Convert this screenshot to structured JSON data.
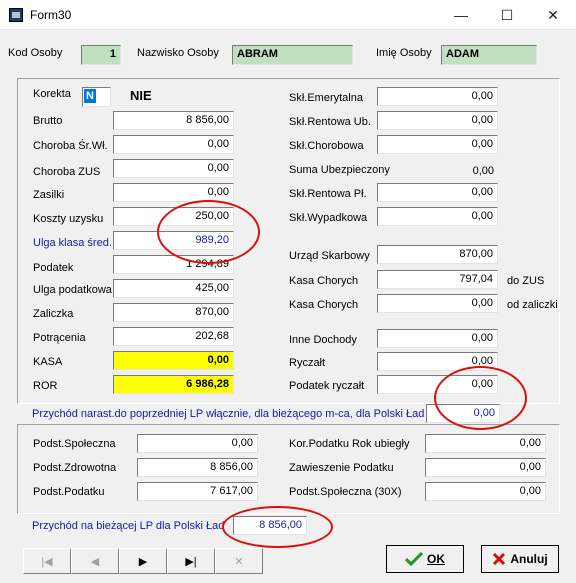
{
  "window": {
    "title": "Form30",
    "controls": {
      "minimize": "—",
      "maximize": "☐",
      "close": "✕"
    }
  },
  "header": {
    "kod_label": "Kod Osoby",
    "kod_value": "1",
    "nazwisko_label": "Nazwisko Osoby",
    "nazwisko_value": "ABRAM",
    "imie_label": "Imię Osoby",
    "imie_value": "ADAM"
  },
  "left": {
    "korekta_label": "Korekta",
    "korekta_value": "N",
    "korekta_text": "NIE",
    "brutto_label": "Brutto",
    "brutto_value": "8 856,00",
    "choroba_sr_label": "Choroba Śr.Wł.",
    "choroba_sr_value": "0,00",
    "choroba_zus_label": "Choroba ZUS",
    "choroba_zus_value": "0,00",
    "zasilki_label": "Zasilki",
    "zasilki_value": "0,00",
    "koszty_label": "Koszty uzysku",
    "koszty_value": "250,00",
    "ulga_klasa_label": "Ulga klasa śred.",
    "ulga_klasa_value": "989,20",
    "podatek_label": "Podatek",
    "podatek_value": "1 294,89",
    "ulga_podatkowa_label": "Ulga podatkowa",
    "ulga_podatkowa_value": "425,00",
    "zaliczka_label": "Zaliczka",
    "zaliczka_value": "870,00",
    "potracenia_label": "Potrącenia",
    "potracenia_value": "202,68",
    "kasa_label": "KASA",
    "kasa_value": "0,00",
    "ror_label": "ROR",
    "ror_value": "6 986,28"
  },
  "right": {
    "skl_emer_label": "Skł.Emerytalna",
    "skl_emer_value": "0,00",
    "skl_rent_ub_label": "Skł.Rentowa Ub.",
    "skl_rent_ub_value": "0,00",
    "skl_chor_label": "Skł.Chorobowa",
    "skl_chor_value": "0,00",
    "suma_label": "Suma Ubezpieczony",
    "suma_value": "0,00",
    "skl_rent_pl_label": "Skł.Rentowa Pł.",
    "skl_rent_pl_value": "0,00",
    "skl_wyp_label": "Skł.Wypadkowa",
    "skl_wyp_value": "0,00",
    "urzad_label": "Urząd Skarbowy",
    "urzad_value": "870,00",
    "kasa_chorych1_label": "Kasa Chorych",
    "kasa_chorych1_value": "797,04",
    "kasa_chorych1_suffix": "do ZUS",
    "kasa_chorych2_label": "Kasa Chorych",
    "kasa_chorych2_value": "0,00",
    "kasa_chorych2_suffix": "od zaliczki",
    "inne_label": "Inne Dochody",
    "inne_value": "0,00",
    "ryczalt_label": "Ryczałt",
    "ryczalt_value": "0,00",
    "podatek_ryczalt_label": "Podatek ryczałt",
    "podatek_ryczalt_value": "0,00"
  },
  "narast": {
    "label": "Przychód narast.do poprzedniej LP włącznie, dla bieżącego m-ca, dla Polski Ład",
    "value": "0,00"
  },
  "bottom": {
    "podst_spol_label": "Podst.Społeczna",
    "podst_spol_value": "0,00",
    "podst_zdr_label": "Podst.Zdrowotna",
    "podst_zdr_value": "8 856,00",
    "podst_pod_label": "Podst.Podatku",
    "podst_pod_value": "7 617,00",
    "kor_label": "Kor.Podatku Rok ubiegły",
    "kor_value": "0,00",
    "zaw_label": "Zawieszenie Podatku",
    "zaw_value": "0,00",
    "podst_spol30_label": "Podst.Społeczna (30X)",
    "podst_spol30_value": "0,00"
  },
  "biezaca": {
    "label": "Przychód na bieżącej  LP dla Polski Ład",
    "value": "8 856,00"
  },
  "nav": {
    "first": "|◀",
    "prev": "◀",
    "next": "▶",
    "last": "▶|",
    "delete": "✕"
  },
  "buttons": {
    "ok_label": "OK",
    "cancel_label": "Anuluj"
  },
  "colors": {
    "highlight_yellow": "#ffff00",
    "readonly_green": "#c0e0c0",
    "annotation_red": "#d81010",
    "ok_green": "#1a9a1a",
    "cancel_red": "#d01010"
  }
}
